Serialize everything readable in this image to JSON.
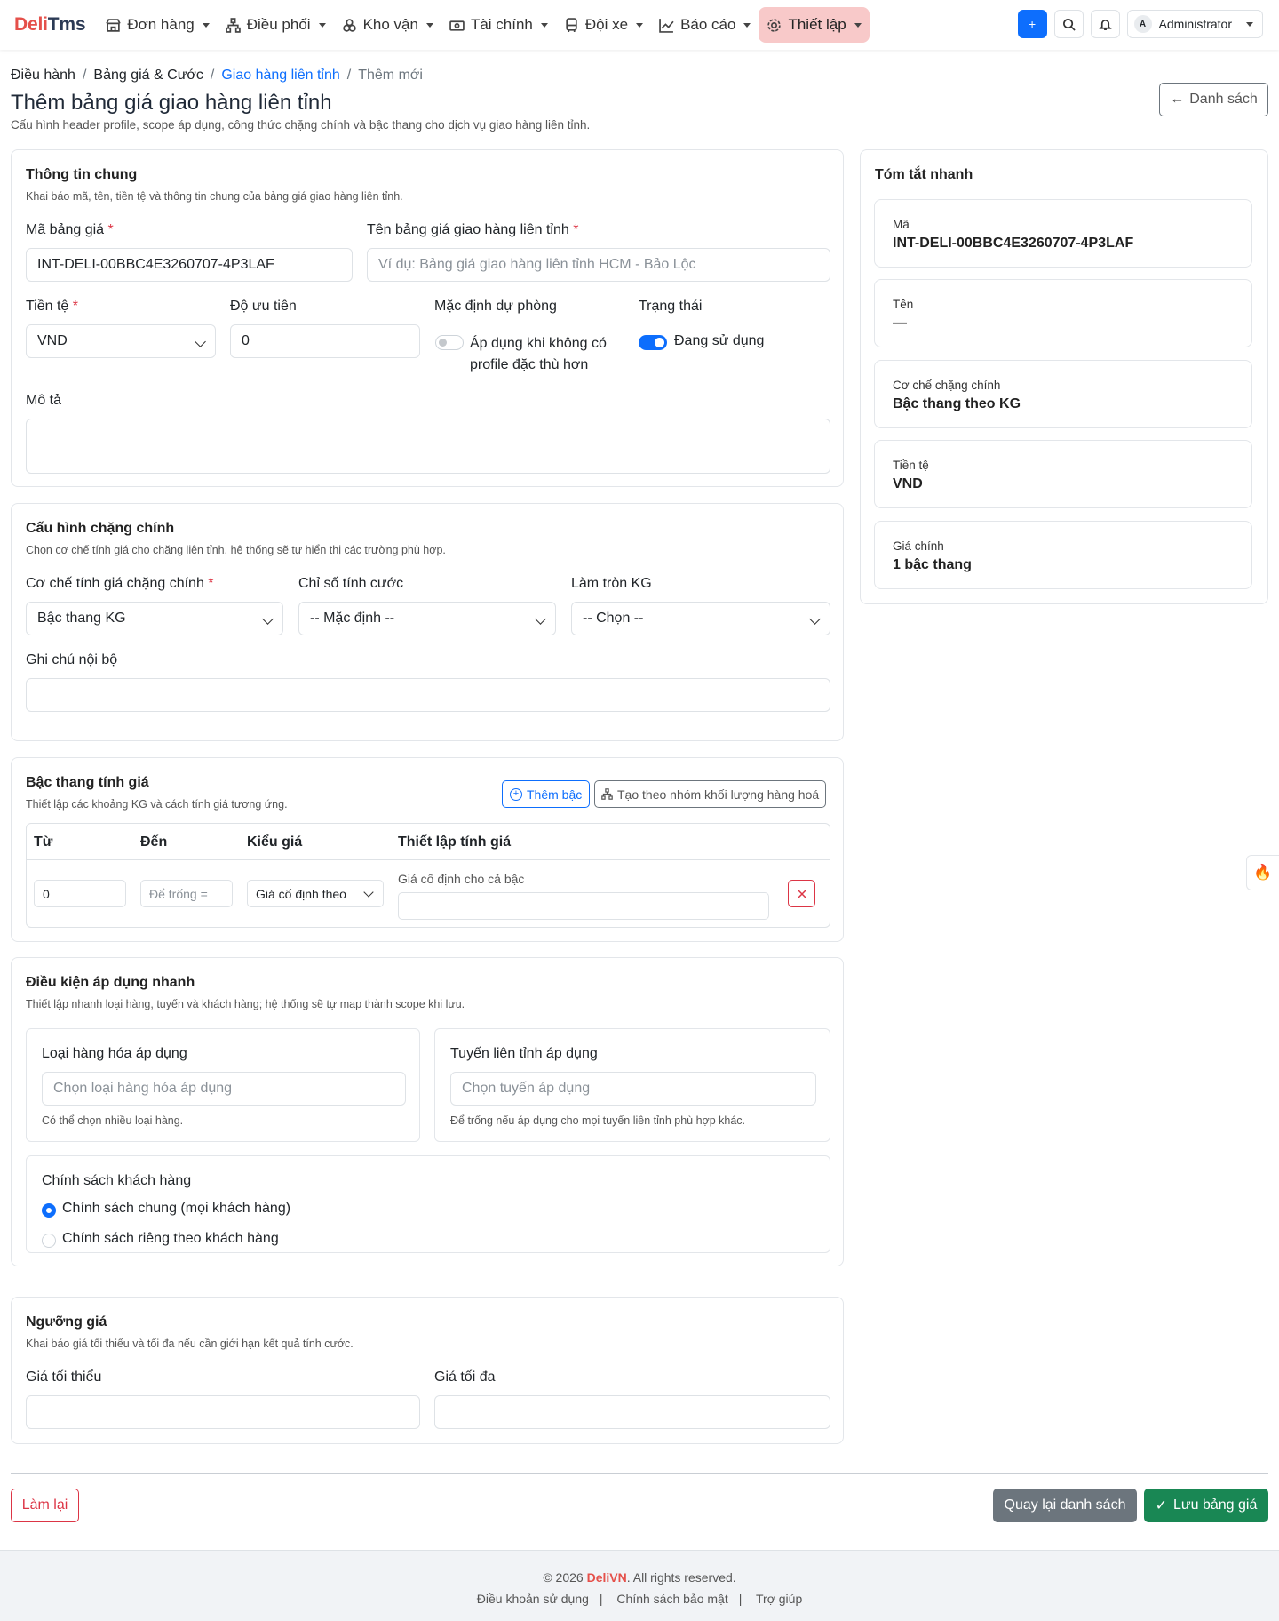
{
  "brand": {
    "part1": "Deli",
    "part2": "Tms"
  },
  "nav": {
    "items": [
      {
        "label": "Đơn hàng",
        "icon": "store-icon"
      },
      {
        "label": "Điều phối",
        "icon": "sitemap-icon"
      },
      {
        "label": "Kho vận",
        "icon": "boxes-icon"
      },
      {
        "label": "Tài chính",
        "icon": "cash-icon"
      },
      {
        "label": "Đội xe",
        "icon": "bus-icon"
      },
      {
        "label": "Báo cáo",
        "icon": "chart-icon"
      },
      {
        "label": "Thiết lập",
        "icon": "gear-icon"
      }
    ],
    "user": "Administrator",
    "avatar_letter": "A"
  },
  "breadcrumb": [
    "Điều hành",
    "Bảng giá & Cước",
    "Giao hàng liên tỉnh",
    "Thêm mới"
  ],
  "page": {
    "title": "Thêm bảng giá giao hàng liên tỉnh",
    "subtitle": "Cấu hình header profile, scope áp dụng, công thức chặng chính và bậc thang cho dịch vụ giao hàng liên tỉnh.",
    "back_label": "Danh sách"
  },
  "general": {
    "title": "Thông tin chung",
    "subtitle": "Khai báo mã, tên, tiền tệ và thông tin chung của bảng giá giao hàng liên tỉnh.",
    "code_label": "Mã bảng giá",
    "code_value": "INT-DELI-00BBC4E3260707-4P3LAF",
    "name_label": "Tên bảng giá giao hàng liên tỉnh",
    "name_placeholder": "Ví dụ: Bảng giá giao hàng liên tỉnh HCM - Bảo Lộc",
    "currency_label": "Tiền tệ",
    "currency_value": "VND",
    "priority_label": "Độ ưu tiên",
    "priority_value": "0",
    "fallback_label": "Mặc định dự phòng",
    "fallback_text_1": "Áp dụng khi không có",
    "fallback_text_2": "profile đặc thù hơn",
    "fallback_on": false,
    "status_label": "Trạng thái",
    "status_text": "Đang sử dụng",
    "status_on": true,
    "desc_label": "Mô tả"
  },
  "main_leg": {
    "title": "Cấu hình chặng chính",
    "subtitle": "Chọn cơ chế tính giá cho chặng liên tỉnh, hệ thống sẽ tự hiển thị các trường phù hợp.",
    "mechanism_label": "Cơ chế tính giá chặng chính",
    "mechanism_value": "Bậc thang KG",
    "index_label": "Chỉ số tính cước",
    "index_value": "-- Mặc định --",
    "rounding_label": "Làm tròn KG",
    "rounding_value": "-- Chọn --",
    "note_label": "Ghi chú nội bộ"
  },
  "tiers": {
    "title": "Bậc thang tính giá",
    "subtitle": "Thiết lập các khoảng KG và cách tính giá tương ứng.",
    "add_label": "Thêm bậc",
    "group_label": "Tạo theo nhóm khối lượng hàng hoá",
    "headers": [
      "Từ",
      "Đến",
      "Kiểu giá",
      "Thiết lập tính giá"
    ],
    "rows": [
      {
        "from": "0",
        "to_placeholder": "Để trống =",
        "type": "Giá cố định theo",
        "setting_label": "Giá cố định cho cả bậc"
      }
    ]
  },
  "conditions": {
    "title": "Điều kiện áp dụng nhanh",
    "subtitle": "Thiết lập nhanh loại hàng, tuyến và khách hàng; hệ thống sẽ tự map thành scope khi lưu.",
    "goods_label": "Loại hàng hóa áp dụng",
    "goods_placeholder": "Chọn loại hàng hóa áp dụng",
    "goods_help": "Có thể chọn nhiều loại hàng.",
    "route_label": "Tuyến liên tỉnh áp dụng",
    "route_placeholder": "Chọn tuyến áp dụng",
    "route_help": "Để trống nếu áp dụng cho mọi tuyến liên tỉnh phù hợp khác.",
    "policy_label": "Chính sách khách hàng",
    "policy_options": [
      "Chính sách chung (mọi khách hàng)",
      "Chính sách riêng theo khách hàng"
    ],
    "policy_selected": 0
  },
  "thresholds": {
    "title": "Ngưỡng giá",
    "subtitle": "Khai báo giá tối thiểu và tối đa nếu cần giới hạn kết quả tính cước.",
    "min_label": "Giá tối thiểu",
    "max_label": "Giá tối đa"
  },
  "summary": {
    "title": "Tóm tắt nhanh",
    "items": [
      {
        "key": "Mã",
        "value": "INT-DELI-00BBC4E3260707-4P3LAF"
      },
      {
        "key": "Tên",
        "value": "—"
      },
      {
        "key": "Cơ chế chặng chính",
        "value": "Bậc thang theo KG"
      },
      {
        "key": "Tiền tệ",
        "value": "VND"
      },
      {
        "key": "Giá chính",
        "value": "1 bậc thang"
      }
    ]
  },
  "actions": {
    "reset": "Làm lại",
    "back": "Quay lại danh sách",
    "save": "Lưu bảng giá"
  },
  "footer": {
    "copy_prefix": "© 2026",
    "brand": "DeliVN",
    "copy_suffix": ". All rights reserved.",
    "links": [
      "Điều khoản sử dụng",
      "Chính sách bảo mật",
      "Trợ giúp"
    ]
  },
  "colors": {
    "primary": "#0d6efd",
    "brand_red": "#e5504a",
    "success": "#198754",
    "danger": "#dc3545"
  }
}
